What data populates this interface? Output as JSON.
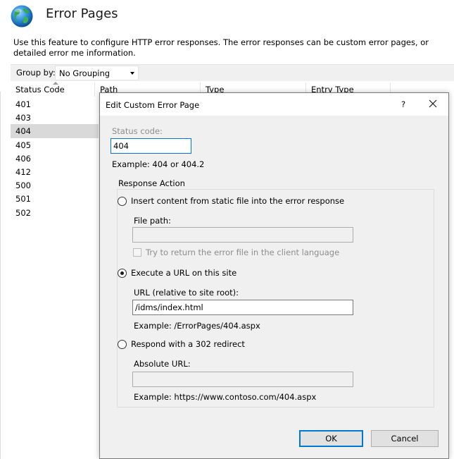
{
  "header": {
    "title": "Error Pages",
    "description": "Use this feature to configure HTTP error responses. The error responses can be custom error pages, or detailed error me information."
  },
  "toolbar": {
    "group_by_label": "Group by:",
    "group_by_value": "No Grouping"
  },
  "list": {
    "columns": [
      "Status Code",
      "Path",
      "Type",
      "Entry Type"
    ],
    "status_codes": [
      "401",
      "403",
      "404",
      "405",
      "406",
      "412",
      "500",
      "501",
      "502"
    ],
    "selected_index": 2
  },
  "dialog": {
    "title": "Edit Custom Error Page",
    "help": "?",
    "status_code_label": "Status code:",
    "status_code_value": "404",
    "status_code_example": "Example: 404 or 404.2",
    "group_title": "Response Action",
    "option_static": "Insert content from static file into the error response",
    "file_path_label": "File path:",
    "file_path_value": "",
    "try_language_label": "Try to return the error file in the client language",
    "option_execute": "Execute a URL on this site",
    "url_label": "URL (relative to site root):",
    "url_value": "/idms/index.html",
    "url_example": "Example: /ErrorPages/404.aspx",
    "option_redirect": "Respond with a 302 redirect",
    "absolute_url_label": "Absolute URL:",
    "absolute_url_value": "",
    "absolute_url_example": "Example: https://www.contoso.com/404.aspx",
    "selected_option": "execute",
    "ok_label": "OK",
    "cancel_label": "Cancel"
  },
  "colors": {
    "accent": "#0078d7",
    "dialog_bg": "#f0f0f0",
    "selected_row": "#d9d9d9",
    "disabled_text": "#8d8d8d"
  },
  "icons": {
    "feature": "globe-icon",
    "close": "close-icon",
    "dropdown": "chevron-down-icon"
  }
}
